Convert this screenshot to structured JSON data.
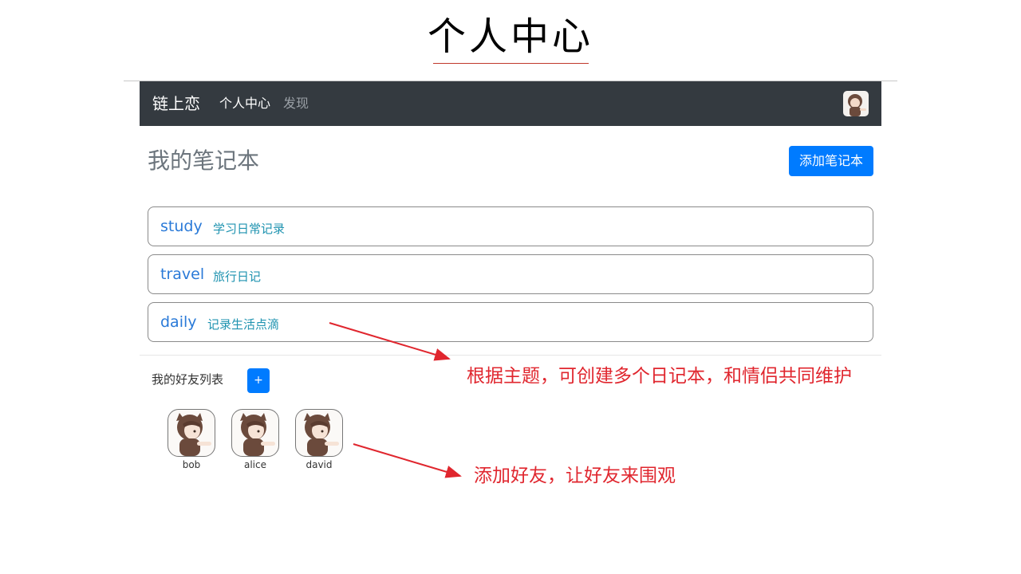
{
  "slide": {
    "title": "个人中心"
  },
  "navbar": {
    "brand": "链上恋",
    "links": [
      {
        "label": "个人中心",
        "active": true
      },
      {
        "label": "发现",
        "active": false
      }
    ],
    "avatar_icon": "user-avatar-icon"
  },
  "main": {
    "heading": "我的笔记本",
    "add_notebook_label": "添加笔记本",
    "notebooks": [
      {
        "name": "study",
        "description": "学习日常记录"
      },
      {
        "name": "travel",
        "description": "旅行日记"
      },
      {
        "name": "daily",
        "description": "记录生活点滴"
      }
    ]
  },
  "friends": {
    "label": "我的好友列表",
    "add_label": "+",
    "list": [
      {
        "name": "bob"
      },
      {
        "name": "alice"
      },
      {
        "name": "david"
      }
    ]
  },
  "annotations": {
    "notebooks_note": "根据主题，可创建多个日记本，和情侣共同维护",
    "friends_note": "添加好友，让好友来围观"
  },
  "colors": {
    "navbar_bg": "#343a40",
    "primary": "#007bff",
    "annotation": "#e0262e",
    "notebook_name": "#2a7ad8",
    "notebook_desc": "#1f93b0"
  }
}
